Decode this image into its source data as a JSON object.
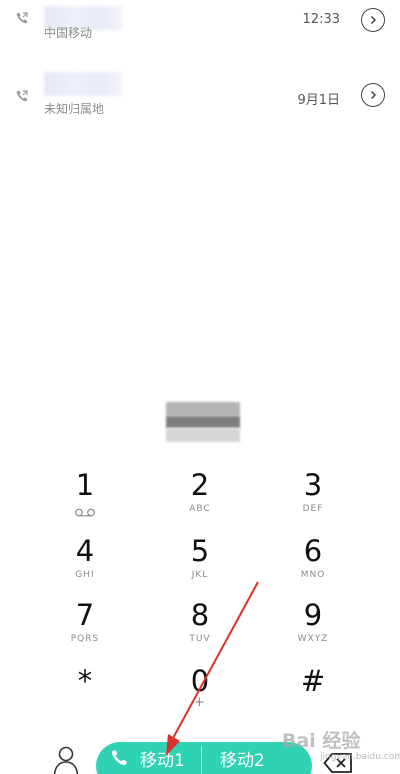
{
  "call_log": [
    {
      "location": "中国移动",
      "time": "12:33"
    },
    {
      "location": "未知归属地",
      "time": "9月1日"
    }
  ],
  "keypad": [
    {
      "digit": "1",
      "letters": ""
    },
    {
      "digit": "2",
      "letters": "ABC"
    },
    {
      "digit": "3",
      "letters": "DEF"
    },
    {
      "digit": "4",
      "letters": "GHI"
    },
    {
      "digit": "5",
      "letters": "JKL"
    },
    {
      "digit": "6",
      "letters": "MNO"
    },
    {
      "digit": "7",
      "letters": "PQRS"
    },
    {
      "digit": "8",
      "letters": "TUV"
    },
    {
      "digit": "9",
      "letters": "WXYZ"
    },
    {
      "digit": "*",
      "letters": ""
    },
    {
      "digit": "0",
      "letters": "+"
    },
    {
      "digit": "#",
      "letters": ""
    }
  ],
  "bottom": {
    "sim1_label": "移动1",
    "sim2_label": "移动2"
  },
  "colors": {
    "call_button": "#2fd3b4",
    "annotation_arrow": "#d8332b"
  },
  "icons": {
    "call_type": "outgoing-call-icon",
    "detail": "chevron-right-circle-icon",
    "voicemail": "voicemail-icon",
    "contacts": "person-icon",
    "sim_call": "phone-icon",
    "delete": "backspace-icon"
  },
  "watermark": {
    "brand": "Bai 经验",
    "sub": "jingyan.baidu.com"
  }
}
